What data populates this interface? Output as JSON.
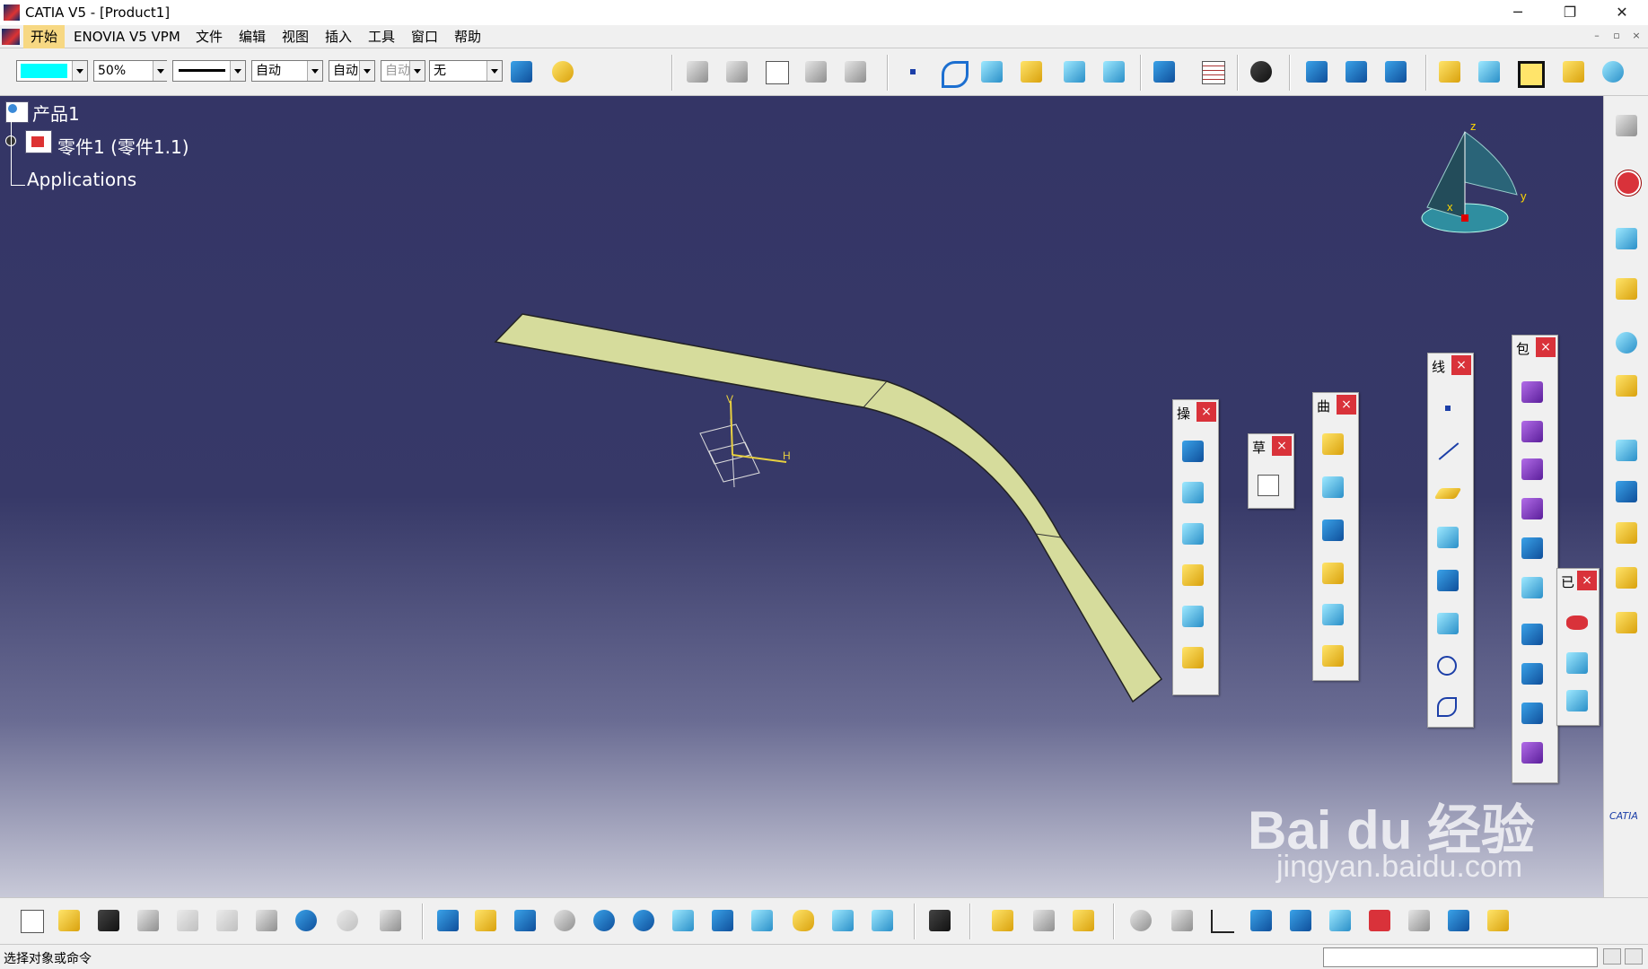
{
  "window": {
    "title": "CATIA V5 - [Product1]",
    "minimize": "─",
    "restore": "❐",
    "close": "✕"
  },
  "menu": {
    "items": [
      "开始",
      "ENOVIA V5 VPM",
      "文件",
      "编辑",
      "视图",
      "插入",
      "工具",
      "窗口",
      "帮助"
    ],
    "mdi_min": "–",
    "mdi_restore": "▫",
    "mdi_close": "×"
  },
  "toolbar_top": {
    "fill_color": "#00ffff",
    "transparency": "50%",
    "line_weight_value": "",
    "line_type": "自动",
    "layer": "自动",
    "layer2": "自动",
    "render_style": "无"
  },
  "tree": {
    "root": "产品1",
    "part": "零件1 (零件1.1)",
    "applications": "Applications"
  },
  "compass": {
    "x": "x",
    "y": "y",
    "z": "z"
  },
  "axis_labels": {
    "v": "V",
    "h": "H"
  },
  "palettes": {
    "operations": {
      "title": "操",
      "close": "×"
    },
    "sketch": {
      "title": "草",
      "close": "×"
    },
    "surfaces": {
      "title": "曲",
      "close": "×"
    },
    "wireframe": {
      "title": "线",
      "close": "×"
    },
    "wrap": {
      "title": "包",
      "close": "×"
    },
    "analysis": {
      "title": "已",
      "close": "×"
    }
  },
  "status": {
    "message": "选择对象或命令"
  },
  "watermark": {
    "brand": "Bai du 经验",
    "url": "jingyan.baidu.com"
  },
  "colors": {
    "viewport_top": "#343566",
    "part_face": "#d6dc9c",
    "part_edge": "#222222",
    "menu_active": "#f7d883",
    "palette_close": "#d9323a"
  }
}
